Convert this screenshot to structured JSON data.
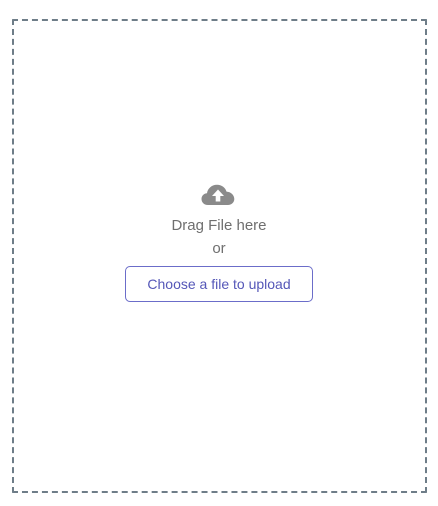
{
  "dropzone": {
    "icon": "cloud-upload-icon",
    "drag_text": "Drag File here",
    "or_text": "or",
    "button_label": "Choose a file to upload"
  },
  "colors": {
    "border": "#6e7d88",
    "icon": "#8a8a8a",
    "text": "#6f6f6f",
    "button_accent": "#6b6dc9"
  }
}
